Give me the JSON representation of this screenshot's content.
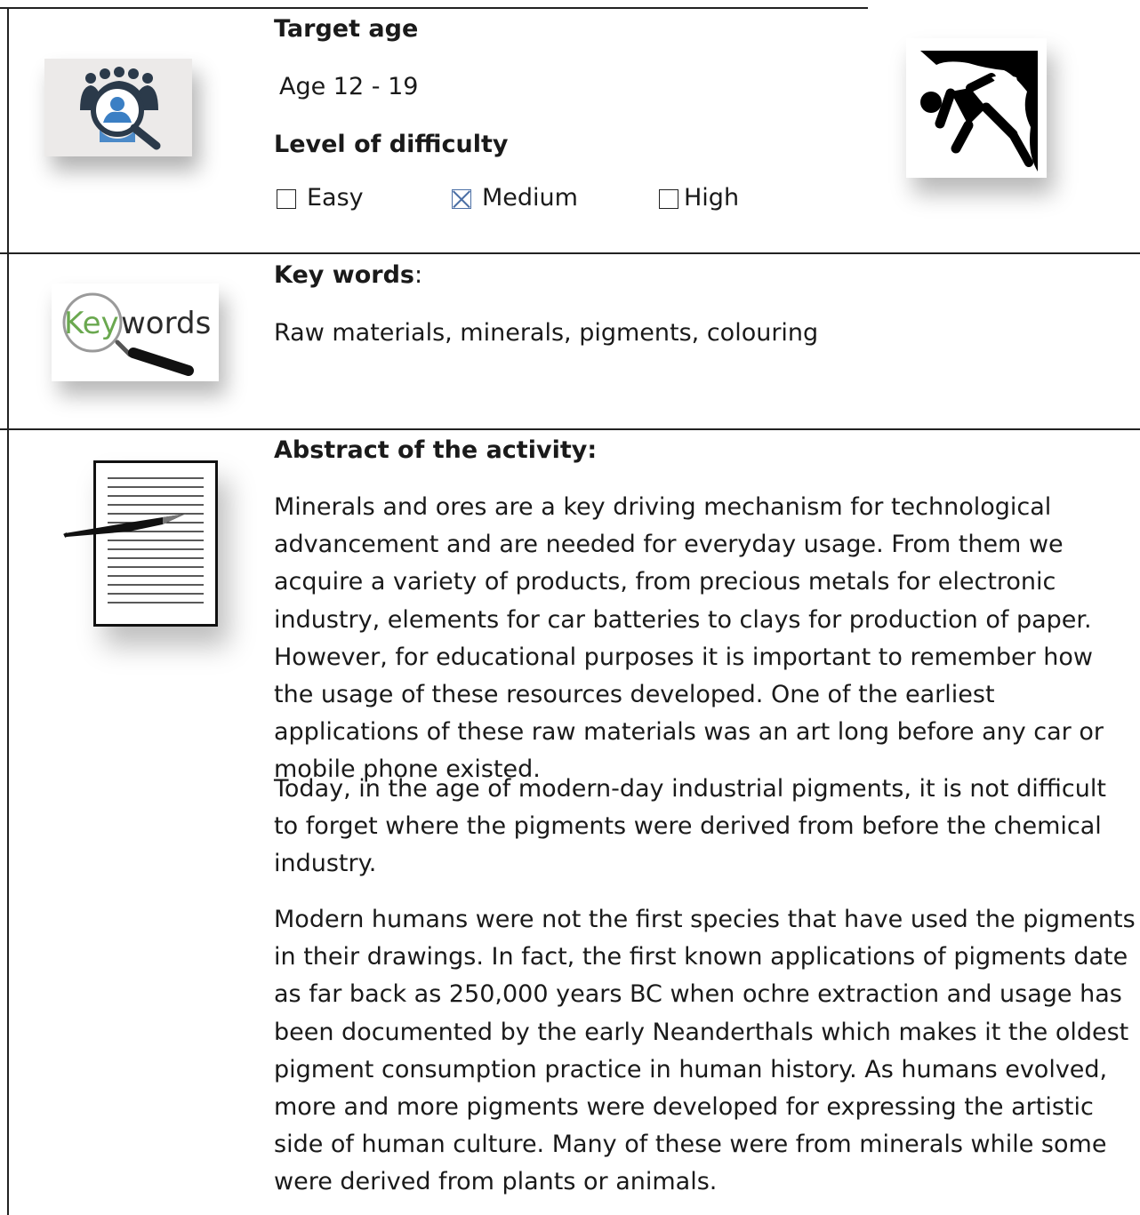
{
  "target_age": {
    "heading": "Target age",
    "value": "Age 12 - 19"
  },
  "difficulty": {
    "heading": "Level of difficulty",
    "options": [
      {
        "label": "Easy",
        "checked": false
      },
      {
        "label": "Medium",
        "checked": true
      },
      {
        "label": "High",
        "checked": false
      }
    ]
  },
  "keywords": {
    "heading": "Key words",
    "heading_suffix": ":",
    "value": "Raw materials, minerals, pigments, colouring",
    "logo_text_key": "Key",
    "logo_text_words": "words"
  },
  "abstract": {
    "heading": "Abstract of the activity:",
    "paragraphs": [
      "Minerals and ores are a key driving mechanism for technological advancement and are needed for everyday usage. From them we acquire a variety of products, from precious metals for electronic industry, elements for car batteries to clays for production of paper. However, for educational purposes it is important to remember how the usage of these resources developed. One of the earliest applications of these raw materials was an art long before any car or mobile phone existed.",
      "Today, in the age of modern-day industrial pigments, it is not difficult to forget where the pigments were derived from before the chemical industry.",
      "Modern humans were not the first species that have used the pigments in their drawings. In fact, the first known applications of pigments date as far back as 250,000 years BC when ochre extraction and usage has been documented by the early Neanderthals which makes it the oldest pigment consumption practice in human history. As humans evolved, more and more pigments were developed for expressing the artistic side of human culture. Many of these were from minerals while some were derived from plants or animals."
    ]
  },
  "colors": {
    "check_blue": "#4b6fa5",
    "keyword_green": "#6aa84f",
    "icon_blue": "#3b7fc4"
  },
  "icons": [
    "audience-search-icon",
    "climber-icon",
    "keywords-magnifier-icon",
    "document-pen-icon"
  ]
}
